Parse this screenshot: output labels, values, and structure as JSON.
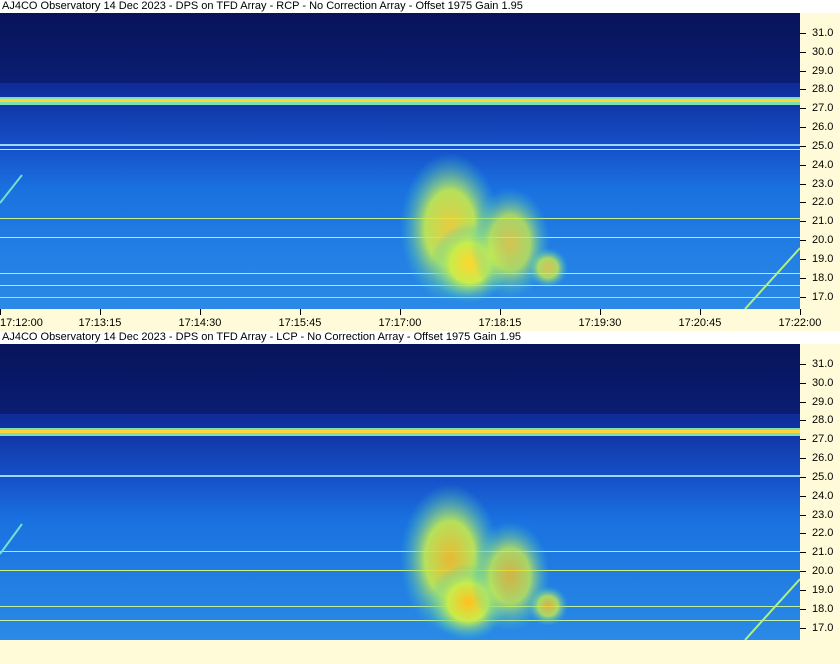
{
  "chart_data": [
    {
      "type": "heatmap",
      "title": "AJ4CO Observatory 14 Dec 2023 - DPS on TFD Array  - RCP  -  No Correction Array  -  Offset 1975  Gain 1.95",
      "y_ticks": [
        "31.0",
        "30.0",
        "29.0",
        "28.0",
        "27.0",
        "26.0",
        "25.0",
        "24.0",
        "23.0",
        "22.0",
        "21.0",
        "20.0",
        "19.0",
        "18.0",
        "17.0"
      ],
      "y_tick_values": [
        31,
        30,
        29,
        28,
        27,
        26,
        25,
        24,
        23,
        22,
        21,
        20,
        19,
        18,
        17
      ],
      "ylim": [
        16.35,
        32.05
      ],
      "x_ticks": [
        "17:12:00",
        "17:13:15",
        "17:14:30",
        "17:15:45",
        "17:17:00",
        "17:18:15",
        "17:19:30",
        "17:20:45",
        "17:22:00"
      ],
      "colors": {
        "low": "#0a1a7a",
        "mid": "#1e78e0",
        "high": "#ffe23a"
      }
    },
    {
      "type": "heatmap",
      "title": "AJ4CO Observatory 14 Dec 2023 - DPS on TFD Array  - LCP  -  No Correction Array  -  Offset 1975  Gain 1.95",
      "y_ticks": [
        "31.0",
        "30.0",
        "29.0",
        "28.0",
        "27.0",
        "26.0",
        "25.0",
        "24.0",
        "23.0",
        "22.0",
        "21.0",
        "20.0",
        "19.0",
        "18.0",
        "17.0"
      ],
      "y_tick_values": [
        31,
        30,
        29,
        28,
        27,
        26,
        25,
        24,
        23,
        22,
        21,
        20,
        19,
        18,
        17
      ],
      "ylim": [
        16.35,
        32.05
      ],
      "x_ticks": [],
      "colors": {
        "low": "#0a1a7a",
        "mid": "#1e78e0",
        "high": "#ffe23a"
      }
    }
  ]
}
